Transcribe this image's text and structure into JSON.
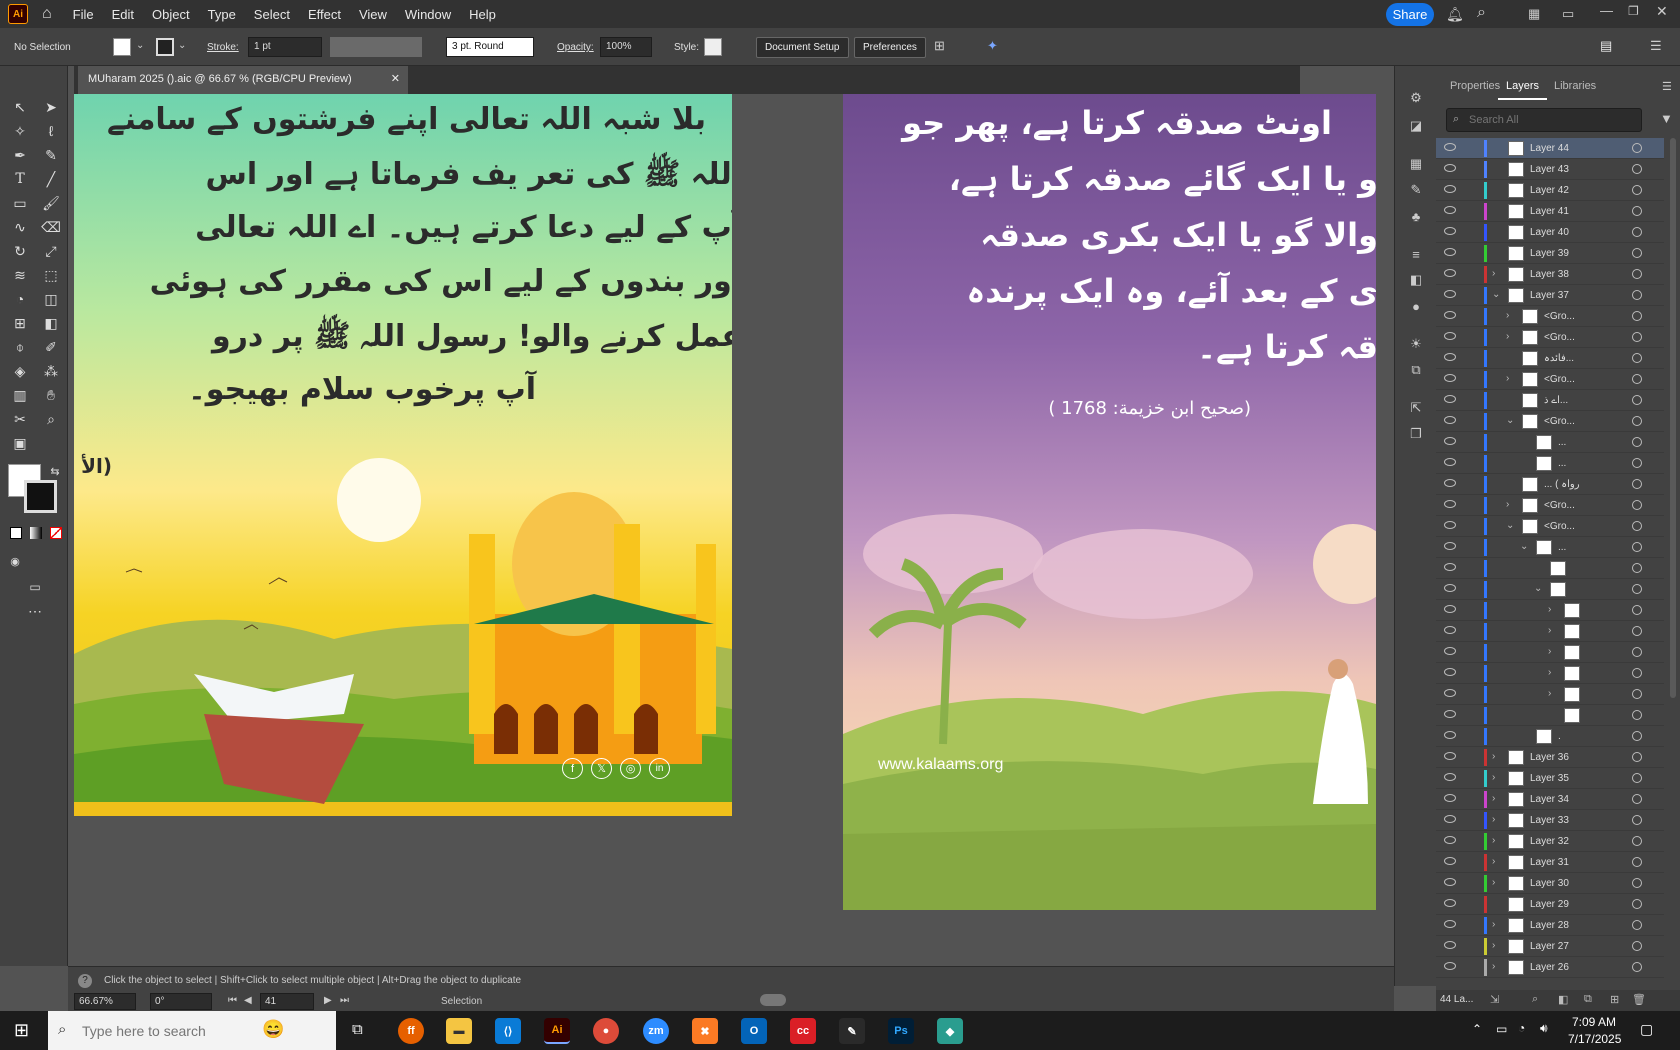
{
  "app": {
    "logo": "Ai",
    "share_label": "Share"
  },
  "menu": [
    "File",
    "Edit",
    "Object",
    "Type",
    "Select",
    "Effect",
    "View",
    "Window",
    "Help"
  ],
  "control": {
    "selection": "No Selection",
    "stroke_label": "Stroke:",
    "stroke_value": "1 pt",
    "brush": "3 pt. Round",
    "opacity_label": "Opacity:",
    "opacity_value": "100%",
    "style_label": "Style:",
    "document_setup": "Document Setup",
    "preferences": "Preferences"
  },
  "document": {
    "tab_title": "MUharam 2025 ().aic @ 66.67 % (RGB/CPU Preview)"
  },
  "artboard_a": {
    "lines": [
      "بلا شبہ اللہ تعالی اپنے فرشتوں کے سامنے",
      "اللہ  ﷺ  کی تعر یف فرماتا ہے اور اس",
      "آپ کے لیے دعا کرتے ہیں۔ اے اللہ تعالی",
      "اور بندوں کے لیے اس کی مقرر کی ہوئی",
      "عمل کرنے والو! رسول اللہ ﷺ  پر درو",
      "آپ پرخوب سلام بھیجو۔"
    ],
    "ref": "(الأ"
  },
  "artboard_b": {
    "lines": [
      "اونٹ صدقہ کرتا ہے، پھر جو",
      "و یا ایک گائے صدقہ کرتا ہے،",
      "والا گو یا ایک بکری صدقہ",
      "ی کے بعد آئے، وہ ایک پرندہ",
      "قہ کرتا ہے۔"
    ],
    "ref": "(صحيح ابن خزيمة: 1768 )",
    "website": "www.kalaams.org"
  },
  "panel": {
    "tabs": [
      "Properties",
      "Layers",
      "Libraries"
    ],
    "search_placeholder": "Search All",
    "footer_count": "44 La..."
  },
  "layers": [
    {
      "name": "Layer 44",
      "color": "#4f82ff",
      "indent": 0,
      "chevron": "",
      "selected": true
    },
    {
      "name": "Layer 43",
      "color": "#4f82ff",
      "indent": 0,
      "chevron": ""
    },
    {
      "name": "Layer 42",
      "color": "#33cccc",
      "indent": 0,
      "chevron": ""
    },
    {
      "name": "Layer 41",
      "color": "#cc44cc",
      "indent": 0,
      "chevron": ""
    },
    {
      "name": "Layer 40",
      "color": "#3355ff",
      "indent": 0,
      "chevron": ""
    },
    {
      "name": "Layer 39",
      "color": "#33cc33",
      "indent": 0,
      "chevron": ""
    },
    {
      "name": "Layer 38",
      "color": "#cc3333",
      "indent": 0,
      "chevron": "›"
    },
    {
      "name": "Layer 37",
      "color": "#3377ff",
      "indent": 0,
      "chevron": "⌄"
    },
    {
      "name": "<Gro...",
      "color": "#3377ff",
      "indent": 1,
      "chevron": "›"
    },
    {
      "name": "<Gro...",
      "color": "#3377ff",
      "indent": 1,
      "chevron": "›"
    },
    {
      "name": "فائدہ...",
      "color": "#3377ff",
      "indent": 1,
      "chevron": ""
    },
    {
      "name": "<Gro...",
      "color": "#3377ff",
      "indent": 1,
      "chevron": "›"
    },
    {
      "name": "اے ذ...",
      "color": "#3377ff",
      "indent": 1,
      "chevron": ""
    },
    {
      "name": "<Gro...",
      "color": "#3377ff",
      "indent": 1,
      "chevron": "⌄"
    },
    {
      "name": "...",
      "color": "#3377ff",
      "indent": 2,
      "chevron": ""
    },
    {
      "name": "...",
      "color": "#3377ff",
      "indent": 2,
      "chevron": ""
    },
    {
      "name": "... ( رواہ",
      "color": "#3377ff",
      "indent": 1,
      "chevron": ""
    },
    {
      "name": "<Gro...",
      "color": "#3377ff",
      "indent": 1,
      "chevron": "›"
    },
    {
      "name": "<Gro...",
      "color": "#3377ff",
      "indent": 1,
      "chevron": "⌄"
    },
    {
      "name": "...",
      "color": "#3377ff",
      "indent": 2,
      "chevron": "⌄"
    },
    {
      "name": "",
      "color": "#3377ff",
      "indent": 3,
      "chevron": ""
    },
    {
      "name": "",
      "color": "#3377ff",
      "indent": 3,
      "chevron": "⌄"
    },
    {
      "name": "",
      "color": "#3377ff",
      "indent": 4,
      "chevron": "›"
    },
    {
      "name": "",
      "color": "#3377ff",
      "indent": 4,
      "chevron": "›"
    },
    {
      "name": "",
      "color": "#3377ff",
      "indent": 4,
      "chevron": "›"
    },
    {
      "name": "",
      "color": "#3377ff",
      "indent": 4,
      "chevron": "›"
    },
    {
      "name": "",
      "color": "#3377ff",
      "indent": 4,
      "chevron": "›"
    },
    {
      "name": "",
      "color": "#3377ff",
      "indent": 4,
      "chevron": ""
    },
    {
      "name": ".",
      "color": "#3377ff",
      "indent": 2,
      "chevron": ""
    },
    {
      "name": "Layer 36",
      "color": "#cc3333",
      "indent": 0,
      "chevron": "›"
    },
    {
      "name": "Layer 35",
      "color": "#33cccc",
      "indent": 0,
      "chevron": "›"
    },
    {
      "name": "Layer 34",
      "color": "#cc44cc",
      "indent": 0,
      "chevron": "›"
    },
    {
      "name": "Layer 33",
      "color": "#3355ff",
      "indent": 0,
      "chevron": "›"
    },
    {
      "name": "Layer 32",
      "color": "#33cc33",
      "indent": 0,
      "chevron": "›"
    },
    {
      "name": "Layer 31",
      "color": "#cc3333",
      "indent": 0,
      "chevron": "›"
    },
    {
      "name": "Layer 30",
      "color": "#33cc33",
      "indent": 0,
      "chevron": "›"
    },
    {
      "name": "Layer 29",
      "color": "#cc3333",
      "indent": 0,
      "chevron": ""
    },
    {
      "name": "Layer 28",
      "color": "#3377ff",
      "indent": 0,
      "chevron": "›"
    },
    {
      "name": "Layer 27",
      "color": "#cccc33",
      "indent": 0,
      "chevron": "›"
    },
    {
      "name": "Layer 26",
      "color": "#aaaaaa",
      "indent": 0,
      "chevron": "›"
    }
  ],
  "status": {
    "hint": "Click the object to select  |  Shift+Click to select multiple object  |  Alt+Drag the object to duplicate",
    "zoom": "66.67%",
    "rotation": "0°",
    "artboard": "41",
    "tool": "Selection"
  },
  "taskbar": {
    "search_placeholder": "Type here to search",
    "time": "7:09 AM",
    "date": "7/17/2025"
  }
}
